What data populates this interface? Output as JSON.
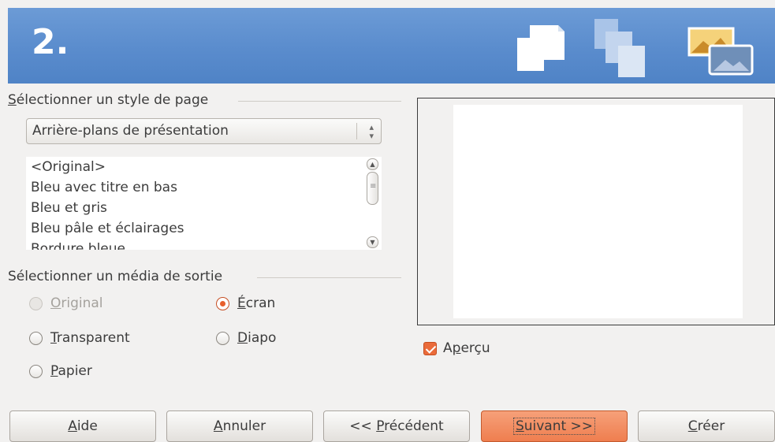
{
  "header": {
    "step": "2.",
    "icons": [
      "page-single-icon",
      "page-stack-icon",
      "image-photo-icon"
    ],
    "colors": {
      "gradient_top": "#6c9bd6",
      "gradient_bottom": "#4f83c6"
    }
  },
  "page_style": {
    "section_label_pre": "",
    "section_label_u": "S",
    "section_label_post": "électionner un style de page",
    "combo_value": "Arrière-plans de présentation",
    "list_items": [
      "<Original>",
      "Bleu avec titre en bas",
      "Bleu et gris",
      "Bleu pâle et éclairages",
      "Bordure bleue"
    ]
  },
  "output_medium": {
    "section_label": "Sélectionner un média de sortie",
    "options": [
      {
        "u": "O",
        "rest": "riginal",
        "checked": false,
        "disabled": true
      },
      {
        "u": "É",
        "rest": "cran",
        "checked": true,
        "disabled": false
      },
      {
        "u": "T",
        "rest": "ransparent",
        "checked": false,
        "disabled": false
      },
      {
        "u": "D",
        "rest": "iapo",
        "checked": false,
        "disabled": false
      },
      {
        "u": "P",
        "rest": "apier",
        "checked": false,
        "disabled": false
      }
    ]
  },
  "preview": {
    "checkbox_pre": "A",
    "checkbox_u": "p",
    "checkbox_post": "erçu",
    "checked": true
  },
  "buttons": {
    "help": {
      "u": "A",
      "rest": "ide"
    },
    "cancel": {
      "u": "A",
      "rest": "nnuler"
    },
    "previous": {
      "pre": "<< ",
      "u": "P",
      "rest": "récédent"
    },
    "next": {
      "u": "S",
      "rest": "uivant >>"
    },
    "create": {
      "u": "C",
      "rest": "réer"
    }
  },
  "colors": {
    "accent": "#ef7e4f",
    "window_bg": "#f2f1f0",
    "text": "#3c3c3c"
  }
}
